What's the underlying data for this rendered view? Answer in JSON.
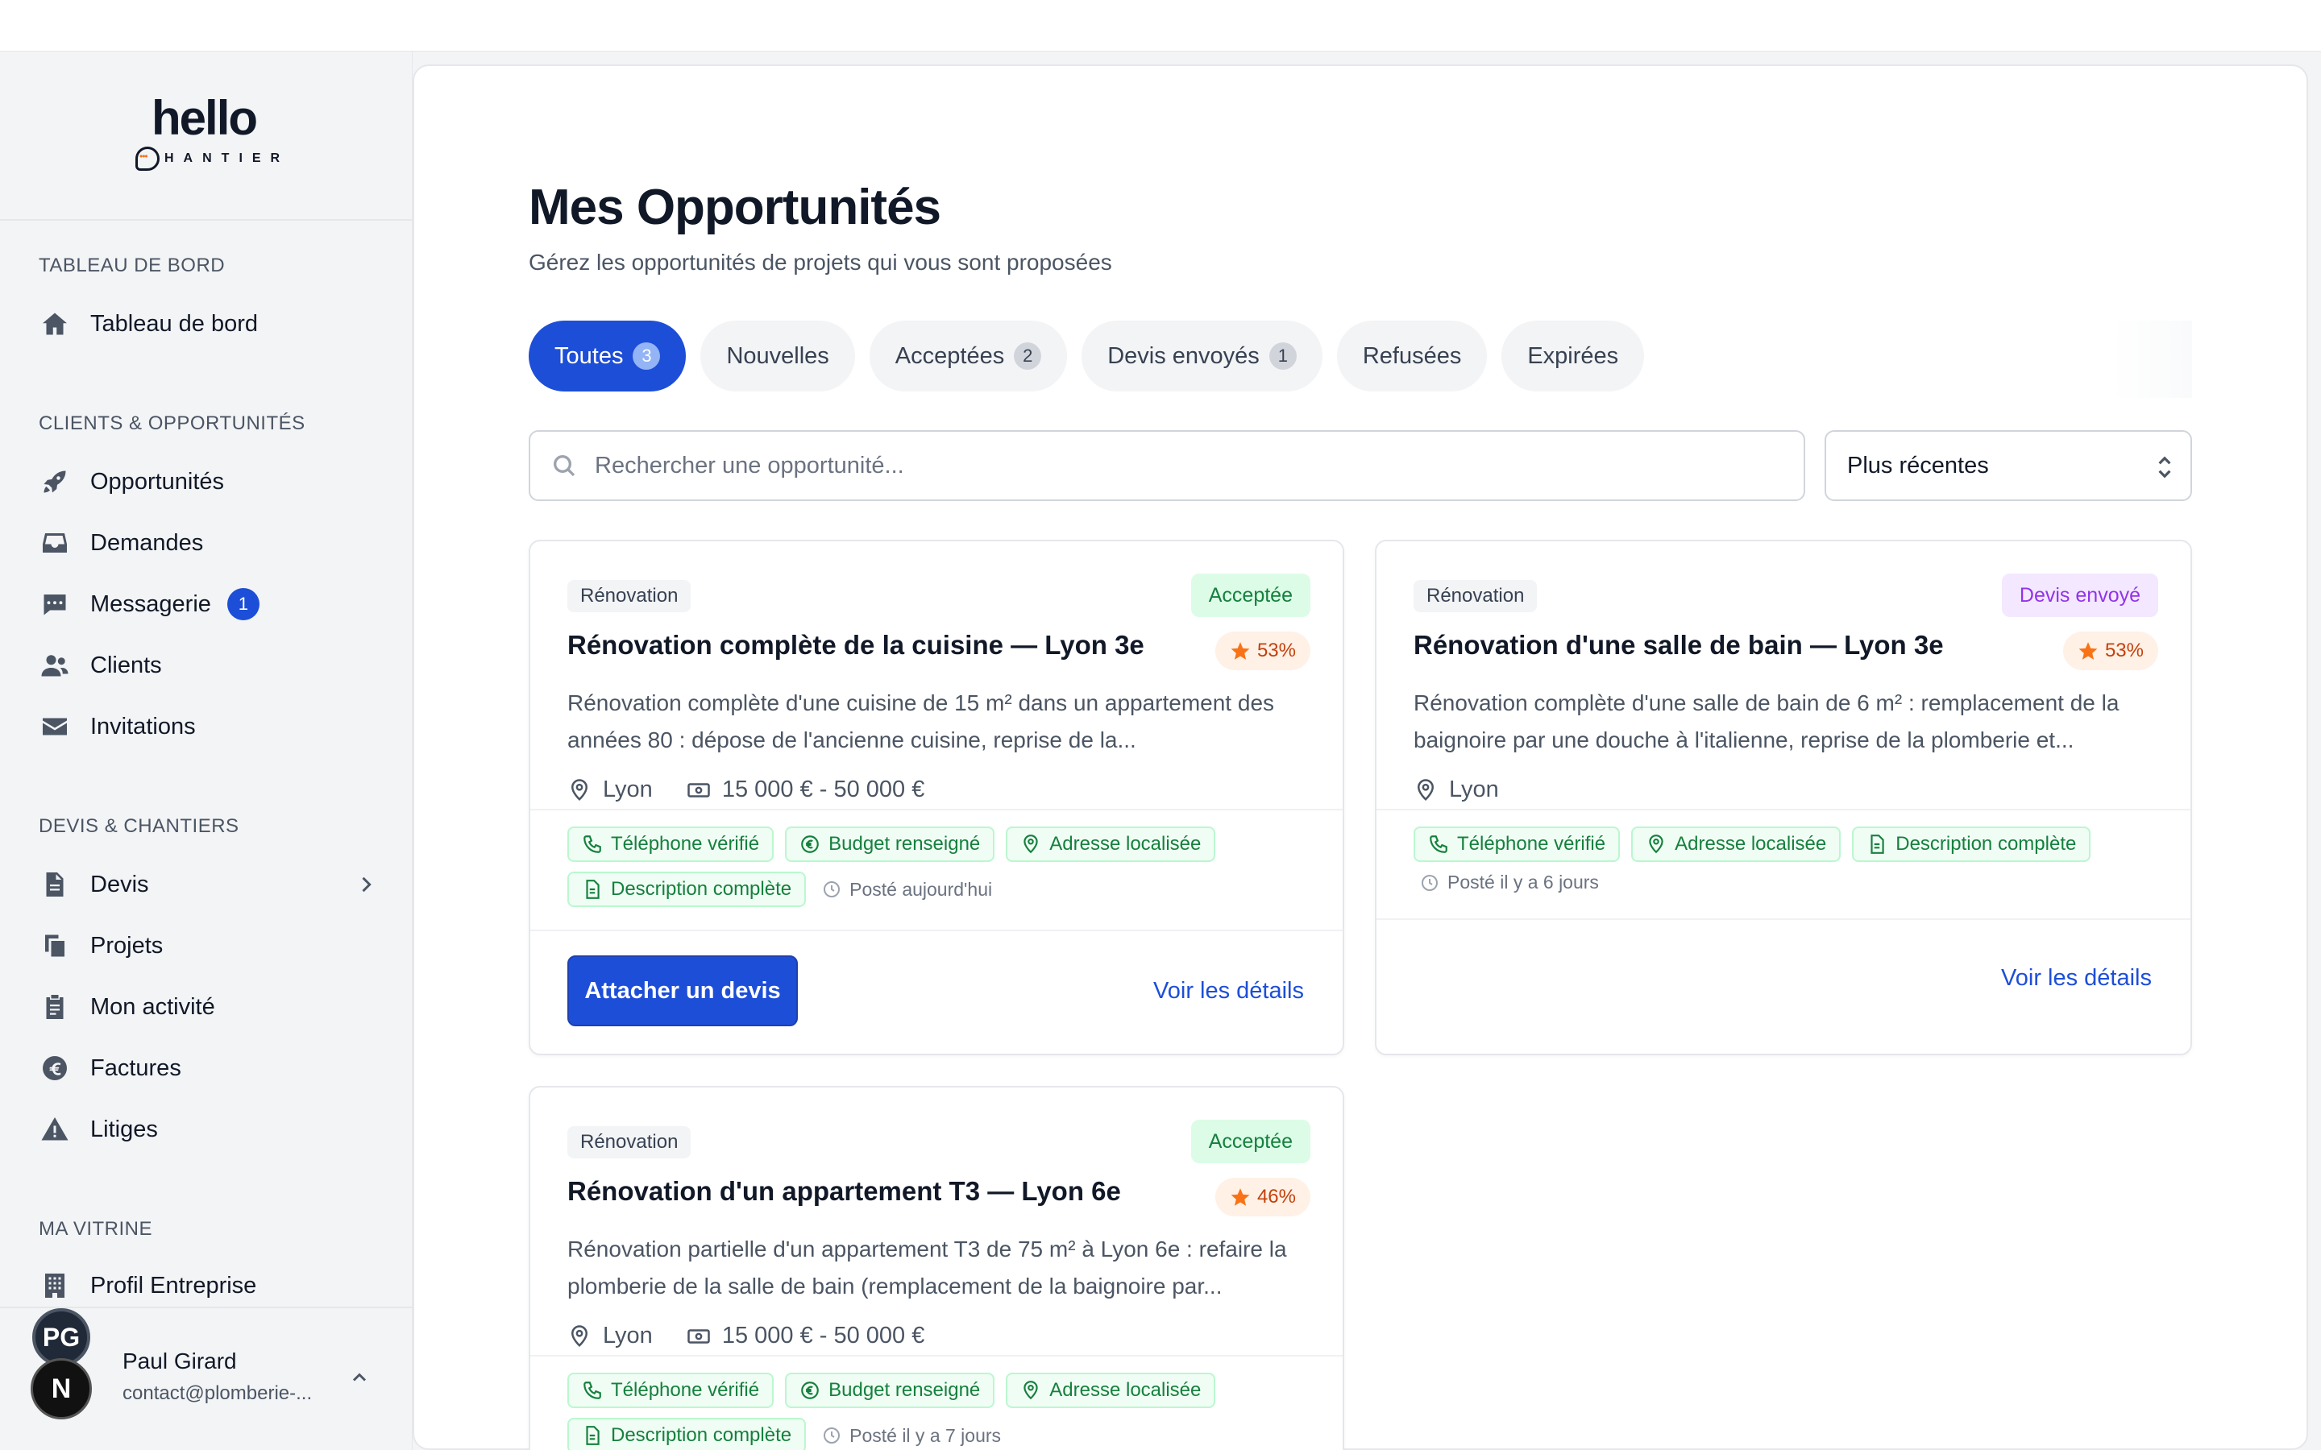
{
  "brand": {
    "hello": "hello",
    "sub": "HANTIER"
  },
  "sidebar": {
    "sections": [
      {
        "label": "TABLEAU DE BORD"
      },
      {
        "label": "CLIENTS & OPPORTUNITÉS"
      },
      {
        "label": "DEVIS & CHANTIERS"
      },
      {
        "label": "MA VITRINE"
      }
    ],
    "items": [
      {
        "label": "Tableau de bord",
        "icon": "home-icon"
      },
      {
        "label": "Opportunités",
        "icon": "rocket-icon"
      },
      {
        "label": "Demandes",
        "icon": "inbox-icon"
      },
      {
        "label": "Messagerie",
        "icon": "chat-icon",
        "badge": "1"
      },
      {
        "label": "Clients",
        "icon": "users-icon"
      },
      {
        "label": "Invitations",
        "icon": "mail-icon"
      },
      {
        "label": "Devis",
        "icon": "file-icon"
      },
      {
        "label": "Projets",
        "icon": "copy-icon"
      },
      {
        "label": "Mon activité",
        "icon": "clipboard-icon"
      },
      {
        "label": "Factures",
        "icon": "euro-icon"
      },
      {
        "label": "Litiges",
        "icon": "warning-icon"
      },
      {
        "label": "Profil Entreprise",
        "icon": "building-icon"
      }
    ],
    "user": {
      "initials": "PG",
      "name": "Paul Girard",
      "email": "contact@plomberie-..."
    }
  },
  "main": {
    "title": "Mes Opportunités",
    "subtitle": "Gérez les opportunités de projets qui vous sont proposées",
    "tabs": [
      {
        "label": "Toutes",
        "count": "3"
      },
      {
        "label": "Nouvelles"
      },
      {
        "label": "Acceptées",
        "count": "2"
      },
      {
        "label": "Devis envoyés",
        "count": "1"
      },
      {
        "label": "Refusées"
      },
      {
        "label": "Expirées"
      }
    ],
    "search": {
      "placeholder": "Rechercher une opportunité..."
    },
    "sort": {
      "value": "Plus récentes"
    }
  },
  "cards": [
    {
      "category": "Rénovation",
      "status": "Acceptée",
      "title": "Rénovation complète de la cuisine — Lyon 3e",
      "score": "53%",
      "description": "Rénovation complète d'une cuisine de 15 m² dans un appartement des années 80 : dépose de l'ancienne cuisine, reprise de la...",
      "city": "Lyon",
      "budget": "15 000 € - 50 000 €",
      "chips": [
        "Téléphone vérifié",
        "Budget renseigné",
        "Adresse localisée",
        "Description complète"
      ],
      "posted": "Posté aujourd'hui",
      "action": "Attacher un devis",
      "link": "Voir les détails"
    },
    {
      "category": "Rénovation",
      "status": "Devis envoyé",
      "title": "Rénovation d'une salle de bain — Lyon 3e",
      "score": "53%",
      "description": "Rénovation complète d'une salle de bain de 6 m² : remplacement de la baignoire par une douche à l'italienne, reprise de la plomberie et...",
      "city": "Lyon",
      "chips": [
        "Téléphone vérifié",
        "Adresse localisée",
        "Description complète"
      ],
      "posted": "Posté il y a 6 jours",
      "link": "Voir les détails"
    },
    {
      "category": "Rénovation",
      "status": "Acceptée",
      "title": "Rénovation d'un appartement T3 — Lyon 6e",
      "score": "46%",
      "description": "Rénovation partielle d'un appartement T3 de 75 m² à Lyon 6e : refaire la plomberie de la salle de bain (remplacement de la baignoire par...",
      "city": "Lyon",
      "budget": "15 000 € - 50 000 €",
      "chips": [
        "Téléphone vérifié",
        "Budget renseigné",
        "Adresse localisée",
        "Description complète"
      ],
      "posted": "Posté il y a 7 jours"
    }
  ],
  "fab": {
    "label": "N"
  },
  "colors": {
    "accent": "#1d4ed8",
    "success": "#15803d",
    "purple": "#9333ea",
    "score": "#f97316"
  }
}
